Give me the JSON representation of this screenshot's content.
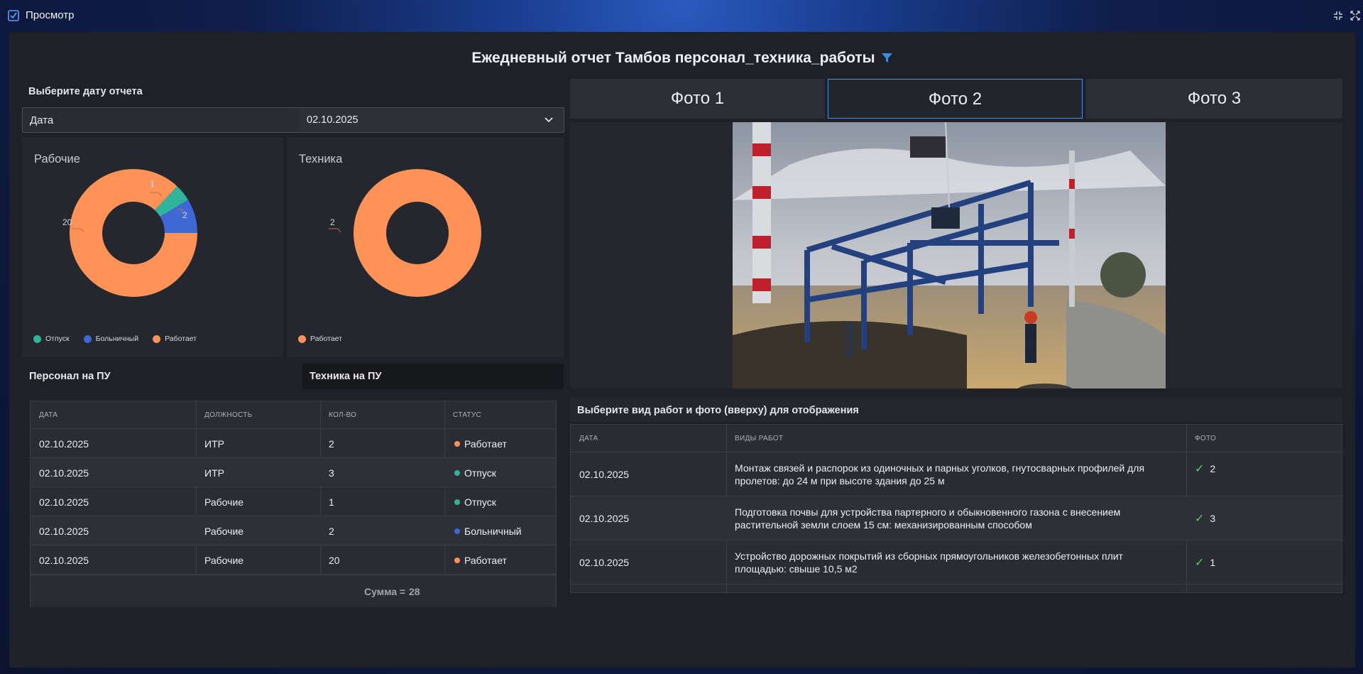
{
  "window": {
    "title": "Просмотр"
  },
  "report": {
    "title": "Ежедневный отчет Тамбов персонал_техника_работы"
  },
  "date_filter": {
    "heading": "Выберите дату отчета",
    "label": "Дата",
    "value": "02.10.2025"
  },
  "charts": {
    "workers": {
      "title": "Рабочие",
      "slices": [
        {
          "name": "Работает",
          "value": 20,
          "color": "#ff9257"
        },
        {
          "name": "Отпуск",
          "value": 1,
          "color": "#2fb39a"
        },
        {
          "name": "Больничный",
          "value": 2,
          "color": "#3f67d6"
        }
      ],
      "value_labels": {
        "working": "20",
        "vacation": "1",
        "sick": "2"
      },
      "legend": [
        "Отпуск",
        "Больничный",
        "Работает"
      ]
    },
    "equipment": {
      "title": "Техника",
      "slices": [
        {
          "name": "Работает",
          "value": 2,
          "color": "#ff9257"
        }
      ],
      "value_labels": {
        "working": "2"
      },
      "legend": [
        "Работает"
      ]
    }
  },
  "chart_data": [
    {
      "type": "pie",
      "title": "Рабочие",
      "categories": [
        "Отпуск",
        "Больничный",
        "Работает"
      ],
      "values": [
        1,
        2,
        20
      ]
    },
    {
      "type": "pie",
      "title": "Техника",
      "categories": [
        "Работает"
      ],
      "values": [
        2
      ]
    }
  ],
  "personnel": {
    "tabs": [
      "Персонал на ПУ",
      "Техника на ПУ"
    ],
    "columns": [
      "ДАТА",
      "ДОЛЖНОСТЬ",
      "КОЛ-ВО",
      "СТАТУС"
    ],
    "rows": [
      {
        "date": "02.10.2025",
        "position": "ИТР",
        "qty": "2",
        "status": "Работает",
        "color": "#ff9257"
      },
      {
        "date": "02.10.2025",
        "position": "ИТР",
        "qty": "3",
        "status": "Отпуск",
        "color": "#2fb39a"
      },
      {
        "date": "02.10.2025",
        "position": "Рабочие",
        "qty": "1",
        "status": "Отпуск",
        "color": "#2fb39a"
      },
      {
        "date": "02.10.2025",
        "position": "Рабочие",
        "qty": "2",
        "status": "Больничный",
        "color": "#3f67d6"
      },
      {
        "date": "02.10.2025",
        "position": "Рабочие",
        "qty": "20",
        "status": "Работает",
        "color": "#ff9257"
      }
    ],
    "sum_label": "Сумма =",
    "sum_value": "28"
  },
  "photos": {
    "tabs": [
      "Фото 1",
      "Фото 2",
      "Фото 3"
    ],
    "active_index": 1
  },
  "works": {
    "heading": "Выберите вид работ и фото (вверху) для отображения",
    "columns": [
      "ДАТА",
      "ВИДЫ РАБОТ",
      "ФОТО"
    ],
    "rows": [
      {
        "date": "02.10.2025",
        "work": "Монтаж связей и распорок из одиночных и парных уголков, гнутосварных профилей для пролетов: до 24 м при высоте здания до 25 м",
        "photo": "2"
      },
      {
        "date": "02.10.2025",
        "work": "Подготовка почвы для устройства партерного и обыкновенного газона с внесением растительной земли слоем 15 см: механизированным способом",
        "photo": "3"
      },
      {
        "date": "02.10.2025",
        "work": "Устройство дорожных покрытий из сборных прямоугольников железобетонных плит площадью: свыше 10,5 м2",
        "photo": "1"
      }
    ]
  },
  "colors": {
    "accent": "#4a8fe0",
    "orange": "#ff9257",
    "teal": "#2fb39a",
    "blue": "#3f67d6",
    "check": "#5cc96b"
  }
}
